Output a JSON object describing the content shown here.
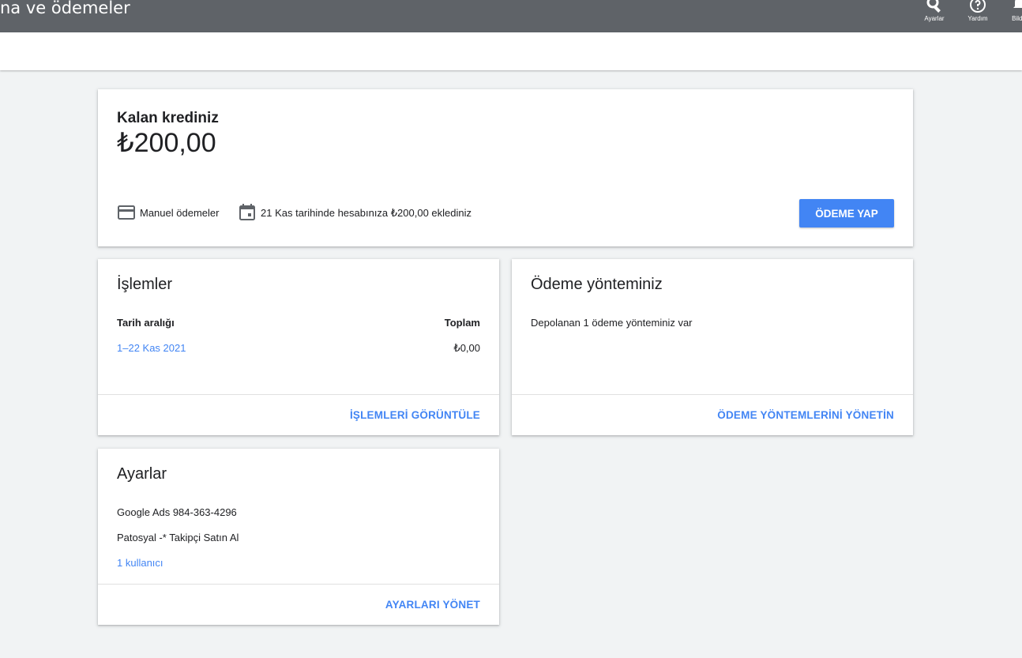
{
  "header": {
    "title": "na ve ödemeler",
    "tools": [
      {
        "label": "Ayarlar",
        "icon": "wrench-icon"
      },
      {
        "label": "Yardım",
        "icon": "help-icon"
      },
      {
        "label": "Bildir",
        "icon": "bell-icon"
      }
    ]
  },
  "credit": {
    "title": "Kalan krediniz",
    "amount": "₺200,00",
    "payment_type": "Manuel ödemeler",
    "last_added": "21 Kas tarihinde hesabınıza ₺200,00 eklediniz",
    "pay_button": "ÖDEME YAP"
  },
  "transactions": {
    "title": "İşlemler",
    "col_range": "Tarih aralığı",
    "col_total": "Toplam",
    "row_range": "1–22 Kas 2021",
    "row_total": "₺0,00",
    "action": "İŞLEMLERİ GÖRÜNTÜLE"
  },
  "payment_method": {
    "title": "Ödeme yönteminiz",
    "description": "Depolanan 1 ödeme yönteminiz var",
    "action": "ÖDEME YÖNTEMLERİNİ YÖNETİN"
  },
  "settings": {
    "title": "Ayarlar",
    "account": "Google Ads 984-363-4296",
    "name": "Patosyal -* Takipçi Satın Al",
    "users": "1 kullanıcı",
    "action": "AYARLARI YÖNET"
  },
  "colors": {
    "topbar": "#5f6368",
    "accent": "#4285f4",
    "background": "#f1f3f4"
  }
}
